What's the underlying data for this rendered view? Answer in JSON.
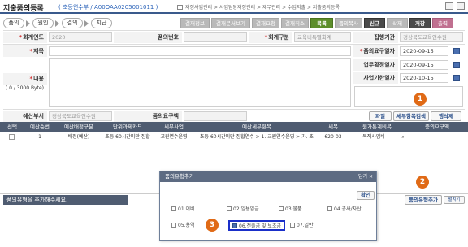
{
  "header": {
    "title": "지출품의등록",
    "subtitle": "( 초등연수부 / A00OAA0205001011 )",
    "breadcrumb": "재정사업관리 > 사업담당재정관리 > 재무관리 > 수입지출 > 지출품의등록"
  },
  "flow": {
    "steps": [
      "품의",
      "원인",
      "결의",
      "지급"
    ]
  },
  "toolbar": {
    "buttons": [
      "결재정보",
      "결재문서보기",
      "결재요청",
      "결재취소",
      "목록",
      "품의복사",
      "신규",
      "삭제",
      "저장",
      "출력"
    ]
  },
  "form": {
    "labels": {
      "year": "회계연도",
      "number": "품의번호",
      "account_type": "회계구분",
      "agency": "집행기관",
      "subject": "제목",
      "request_date": "품의요구일자",
      "work_date": "업무확정일자",
      "deadline": "사업기한일자",
      "content": "내용",
      "content_limit": "( 0 / 3000 Byte)",
      "dept": "예산부서",
      "amount": "품의요구액"
    },
    "values": {
      "year": "2020",
      "account_type": "교육비특별회계",
      "agency": "경상북도교육연수원",
      "request_date": "2020-09-15",
      "work_date": "2020-09-15",
      "deadline": "2020-10-15",
      "dept": "경상북도교육연수원"
    }
  },
  "actions": {
    "file": "파일",
    "detail_search": "세부항목검색",
    "row_add": "행삭제"
  },
  "grid": {
    "headers": [
      "선택",
      "예산순번",
      "예산배정구분",
      "단위과제카드",
      "세부사업",
      "예산세부항목",
      "세목",
      "원가통계비목",
      "증의요구액"
    ],
    "rows": [
      [
        "",
        "1",
        "배정(예산)",
        "초등 60시간미만 집합",
        "교원연수운영",
        "초등 60시간미만 집합연수 > 1. 교원연수운영 > 가. 초",
        "620-03",
        "목적사업비",
        ""
      ]
    ]
  },
  "hint": "품의유형을 추가해주세요.",
  "dialog": {
    "title": "품의유형추가",
    "close": "닫기",
    "confirm": "확인",
    "options": [
      {
        "label": "01.여비",
        "checked": false
      },
      {
        "label": "02.일용임금",
        "checked": false
      },
      {
        "label": "03.물품",
        "checked": false
      },
      {
        "label": "04.공사/자산",
        "checked": false
      },
      {
        "label": "05.용역",
        "checked": false
      },
      {
        "label": "06.전출금 및 보조금",
        "checked": true
      },
      {
        "label": "07.일반",
        "checked": false
      }
    ]
  },
  "side": {
    "add_type": "품의유형추가",
    "collapse": "펼치기"
  },
  "badges": [
    "1",
    "2",
    "3"
  ],
  "colors": {
    "accent": "#3a5a8c",
    "highlight": "#1a2fc9",
    "badge": "#e06a16"
  }
}
